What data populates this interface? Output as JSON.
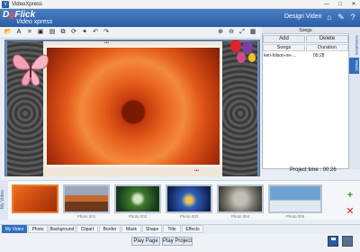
{
  "window": {
    "title": "VideoXpress",
    "minimize_glyph": "—",
    "maximize_glyph": "□",
    "close_glyph": "✕"
  },
  "header": {
    "logo_top_prefix": "D",
    "logo_top_dot": "g",
    "logo_top_suffix": "Flick",
    "logo_bottom": "Video xpress",
    "design_video": "Design Video",
    "icons": [
      "home-icon",
      "settings-icon",
      "help-icon"
    ]
  },
  "toolbar": {
    "icons": [
      "open-icon",
      "text-icon",
      "crop-icon",
      "send-back-icon",
      "layers-icon",
      "transition-icon",
      "rotate-icon",
      "undo-icon",
      "redo-icon",
      "zoom-in-icon",
      "zoom-out-icon",
      "fit-icon",
      "grid-icon",
      "dropdown-icon"
    ]
  },
  "songs_panel": {
    "header": "Songs",
    "add_label": "Add",
    "delete_label": "Delete",
    "columns": [
      "Songs",
      "Duration"
    ],
    "rows": [
      {
        "song": "keri-hilson-ne-...",
        "duration": "05:28"
      }
    ],
    "side_tabs": [
      "Animations",
      "Music"
    ]
  },
  "project_time": {
    "label": "Project time :",
    "value": "00:26"
  },
  "filmstrip": {
    "vertical_label": "My Video",
    "captions": [
      "",
      "Photo 001",
      "Photo 002",
      "Photo 003",
      "Photo 004",
      "Photo 005",
      "Photo 006"
    ],
    "colors": [
      "#e24a12",
      "#b85a24",
      "#2f6b2e",
      "#1b3c8a",
      "#8a8a7e",
      "#2c5f8f",
      "#b0c4cf"
    ]
  },
  "bottom_tabs": {
    "items": [
      "My Video",
      "Photo",
      "Background",
      "Clipart",
      "Border",
      "Mask",
      "Shape",
      "Title",
      "Effects"
    ],
    "active": "My Video"
  },
  "footer": {
    "play_page": "Play Page",
    "play_project": "Play Project"
  },
  "accent": "#2e6fbf"
}
